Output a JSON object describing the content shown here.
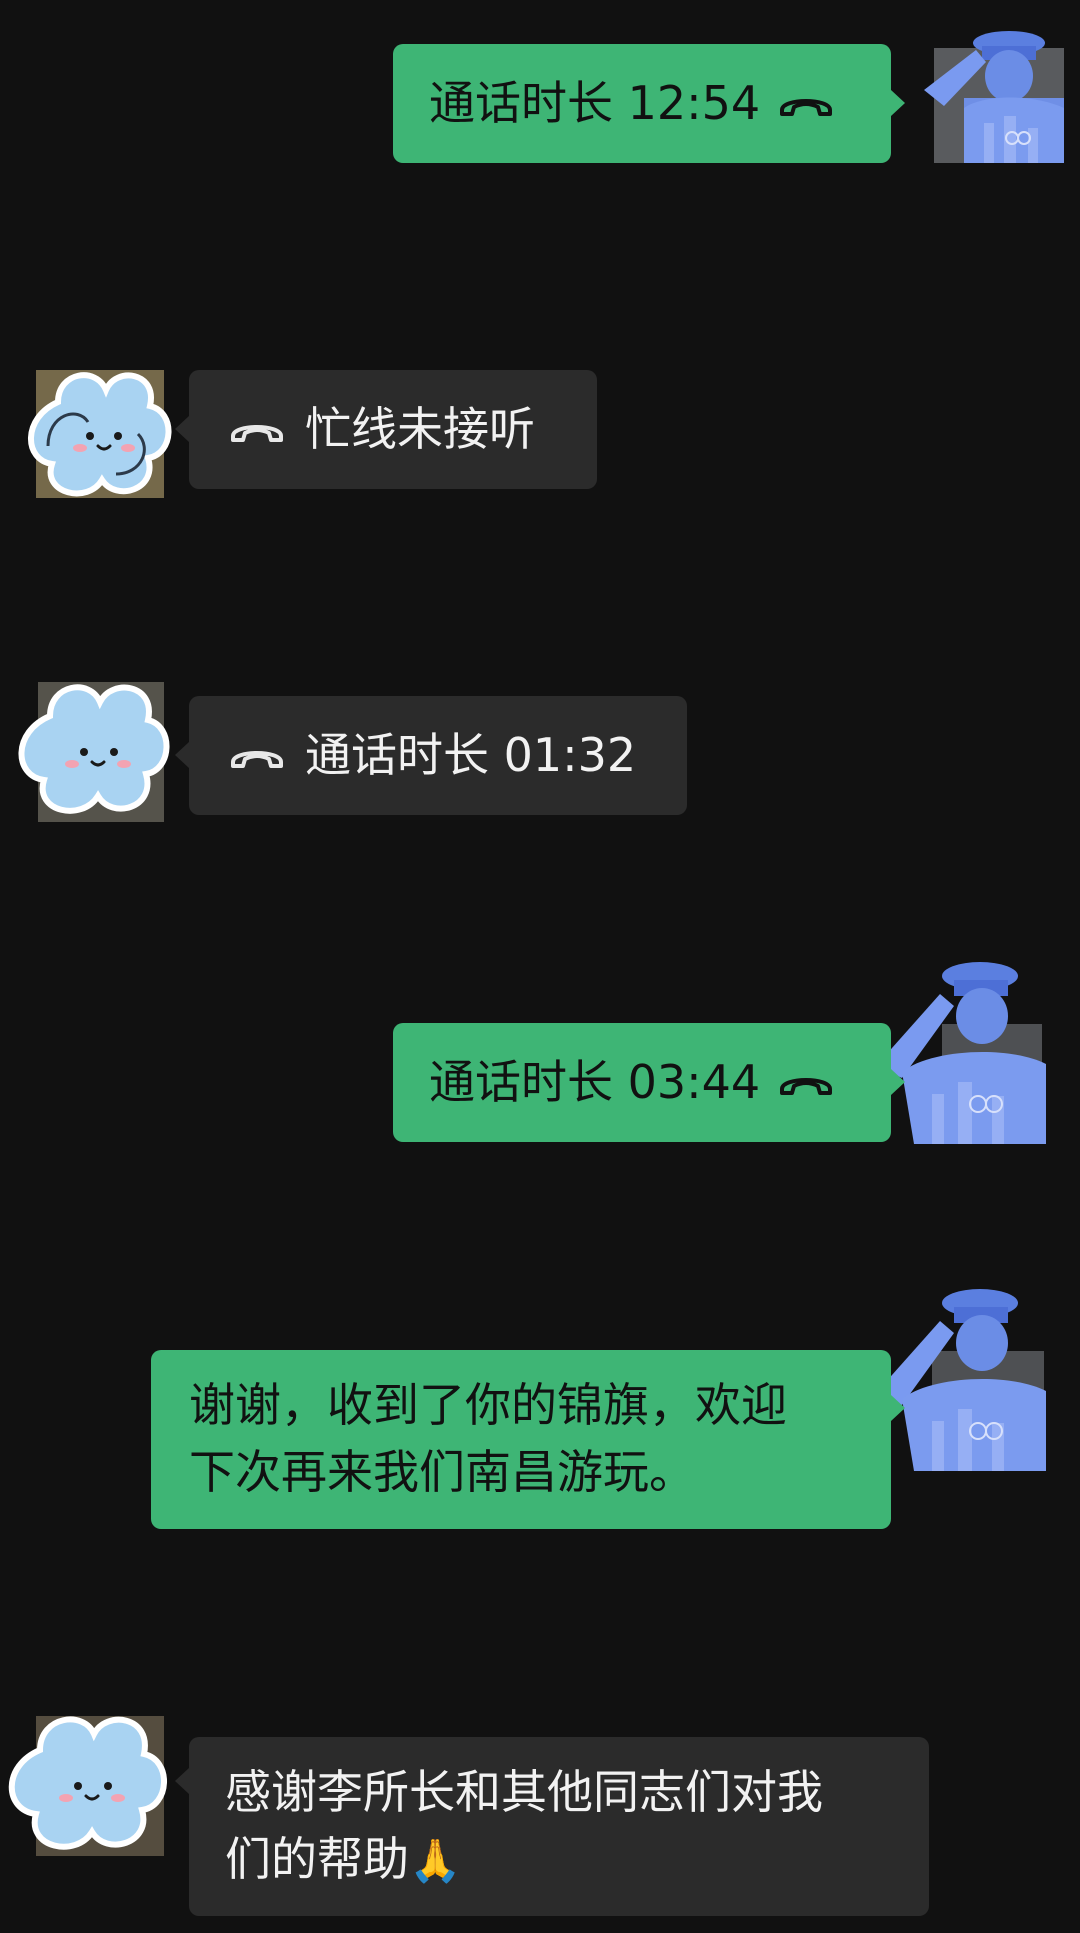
{
  "messages": [
    {
      "direction": "outgoing",
      "type": "call",
      "text": "通话时长 12:54",
      "icon": "phone-hangup-icon"
    },
    {
      "direction": "incoming",
      "type": "call",
      "text": "忙线未接听",
      "icon": "phone-hangup-icon"
    },
    {
      "direction": "incoming",
      "type": "call",
      "text": "通话时长 01:32",
      "icon": "phone-hangup-icon"
    },
    {
      "direction": "outgoing",
      "type": "call",
      "text": "通话时长 03:44",
      "icon": "phone-hangup-icon"
    },
    {
      "direction": "outgoing",
      "type": "text",
      "text": "谢谢，收到了你的锦旗，欢迎\n下次再来我们南昌游玩。"
    },
    {
      "direction": "incoming",
      "type": "text",
      "text": "感谢李所长和其他同志们对我\n们的帮助",
      "emoji": "🙏"
    }
  ],
  "avatars": {
    "self": "police-salute-avatar",
    "contact": "cloud-face-avatar"
  },
  "colors": {
    "background": "#111111",
    "outgoing_bubble": "#3eb575",
    "incoming_bubble": "#2b2b2b"
  }
}
